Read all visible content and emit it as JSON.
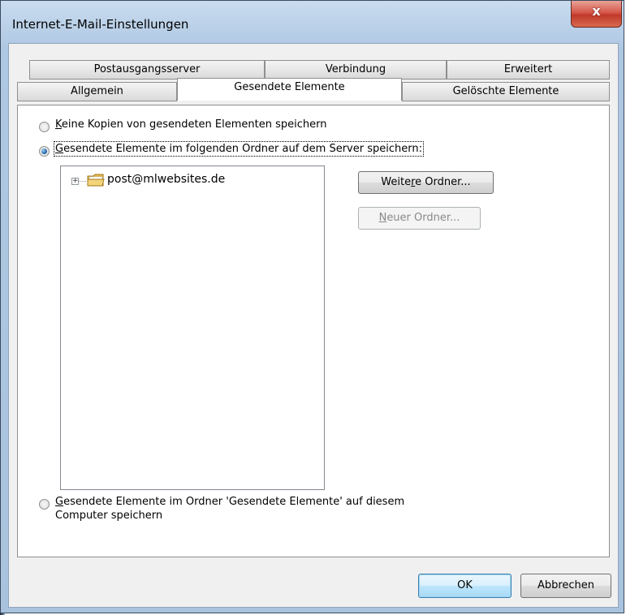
{
  "window": {
    "title": "Internet-E-Mail-Einstellungen",
    "close_glyph": "x"
  },
  "tabs": {
    "row1": [
      {
        "label": "Postausgangsserver"
      },
      {
        "label": "Verbindung"
      },
      {
        "label": "Erweitert"
      }
    ],
    "row2": [
      {
        "label": "Allgemein"
      },
      {
        "label": "Gesendete Elemente",
        "active": true
      },
      {
        "label": "Gelöschte Elemente"
      }
    ]
  },
  "options": {
    "no_copies": {
      "label_first": "K",
      "label_rest": "eine Kopien von gesendeten Elementen speichern",
      "checked": false
    },
    "server_folder": {
      "label_first": "G",
      "label_rest": "esendete Elemente im folgenden Ordner auf dem Server speichern:",
      "checked": true
    },
    "local_folder": {
      "label_first": "G",
      "label_rest": "esendete Elemente im Ordner 'Gesendete Elemente' auf diesem",
      "label_line2": "Computer speichern",
      "checked": false
    }
  },
  "tree": {
    "items": [
      {
        "label": "post@mlwebsites.de",
        "icon": "folder-icon",
        "expander": "+"
      }
    ]
  },
  "buttons": {
    "more_folders": {
      "label_a": "Weite",
      "label_u": "r",
      "label_b": "e Ordner..."
    },
    "new_folder": {
      "label_u": "N",
      "label_b": "euer Ordner...",
      "disabled": true
    },
    "ok": "OK",
    "cancel": "Abbrechen"
  }
}
